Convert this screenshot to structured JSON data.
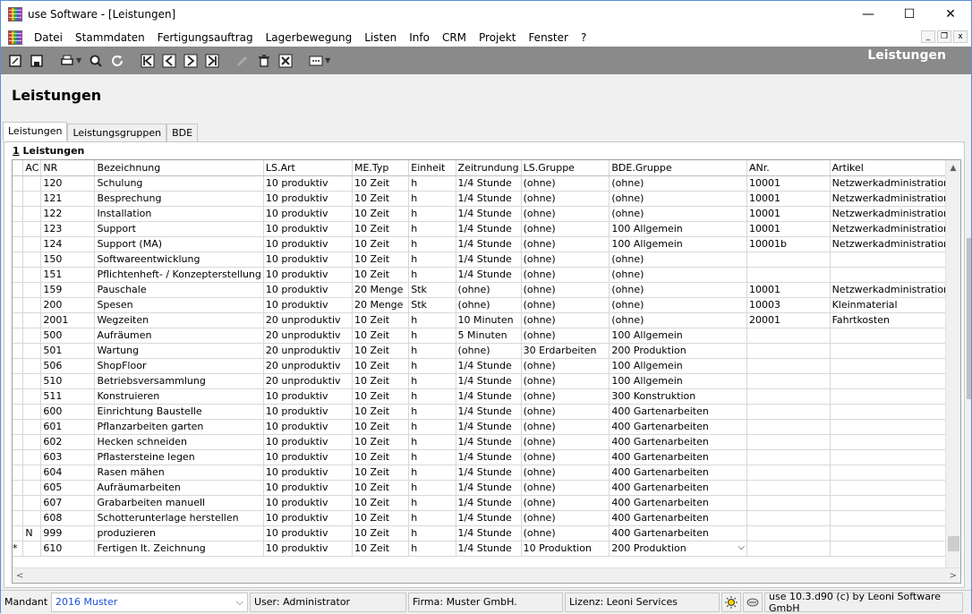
{
  "window": {
    "title": "use Software - [Leistungen]",
    "minimize": "—",
    "maximize": "☐",
    "close": "✕"
  },
  "menu": [
    "Datei",
    "Stammdaten",
    "Fertigungsauftrag",
    "Lagerbewegung",
    "Listen",
    "Info",
    "CRM",
    "Projekt",
    "Fenster",
    "?"
  ],
  "mdi": {
    "minimize": "_",
    "restore": "❐",
    "close": "x"
  },
  "toolbar": {
    "title": "Leistungen",
    "icons": [
      "new-icon",
      "save-icon",
      "print-icon",
      "search-icon",
      "refresh-icon",
      "first-record-icon",
      "previous-record-icon",
      "next-record-icon",
      "last-record-icon",
      "edit-icon",
      "delete-icon",
      "cancel-icon",
      "more-icon"
    ]
  },
  "page": {
    "title": "Leistungen",
    "tabs": [
      "Leistungen",
      "Leistungsgruppen",
      "BDE"
    ],
    "active_tab": "Leistungen",
    "group_number": "1",
    "group_label": " Leistungen"
  },
  "grid": {
    "columns": [
      "",
      "AC",
      "NR",
      "Bezeichnung",
      "LS.Art",
      "ME.Typ",
      "Einheit",
      "Zeitrundung",
      "LS.Gruppe",
      "BDE.Gruppe",
      "ANr.",
      "Artikel"
    ],
    "rows": [
      [
        "",
        "",
        "120",
        "Schulung",
        "10  produktiv",
        "10  Zeit",
        "h",
        "1/4 Stunde",
        "(ohne)",
        "(ohne)",
        "10001",
        "Netzwerkadministration"
      ],
      [
        "",
        "",
        "121",
        "Besprechung",
        "10  produktiv",
        "10  Zeit",
        "h",
        "1/4 Stunde",
        "(ohne)",
        "(ohne)",
        "10001",
        "Netzwerkadministration"
      ],
      [
        "",
        "",
        "122",
        "Installation",
        "10  produktiv",
        "10  Zeit",
        "h",
        "1/4 Stunde",
        "(ohne)",
        "(ohne)",
        "10001",
        "Netzwerkadministration"
      ],
      [
        "",
        "",
        "123",
        "Support",
        "10  produktiv",
        "10  Zeit",
        "h",
        "1/4 Stunde",
        "(ohne)",
        "100  Allgemein",
        "10001",
        "Netzwerkadministration"
      ],
      [
        "",
        "",
        "124",
        "Support (MA)",
        "10  produktiv",
        "10  Zeit",
        "h",
        "1/4 Stunde",
        "(ohne)",
        "100  Allgemein",
        "10001b",
        "Netzwerkadministration"
      ],
      [
        "",
        "",
        "150",
        "Softwareentwicklung",
        "10  produktiv",
        "10  Zeit",
        "h",
        "1/4 Stunde",
        "(ohne)",
        "(ohne)",
        "",
        ""
      ],
      [
        "",
        "",
        "151",
        "Pflichtenheft- / Konzepterstellung",
        "10  produktiv",
        "10  Zeit",
        "h",
        "1/4 Stunde",
        "(ohne)",
        "(ohne)",
        "",
        ""
      ],
      [
        "",
        "",
        "159",
        "Pauschale",
        "10  produktiv",
        "20  Menge",
        "Stk",
        "(ohne)",
        "(ohne)",
        "(ohne)",
        "10001",
        "Netzwerkadministration"
      ],
      [
        "",
        "",
        "200",
        "Spesen",
        "10  produktiv",
        "20  Menge",
        "Stk",
        "(ohne)",
        "(ohne)",
        "(ohne)",
        "10003",
        "Kleinmaterial"
      ],
      [
        "",
        "",
        "2001",
        "Wegzeiten",
        "20  unproduktiv",
        "10  Zeit",
        "h",
        "10 Minuten",
        "(ohne)",
        "(ohne)",
        "20001",
        "Fahrtkosten"
      ],
      [
        "",
        "",
        "500",
        "Aufräumen",
        "20  unproduktiv",
        "10  Zeit",
        "h",
        "5 Minuten",
        "(ohne)",
        "100  Allgemein",
        "",
        ""
      ],
      [
        "",
        "",
        "501",
        "Wartung",
        "20  unproduktiv",
        "10  Zeit",
        "h",
        "(ohne)",
        "30  Erdarbeiten",
        "200  Produktion",
        "",
        ""
      ],
      [
        "",
        "",
        "506",
        "ShopFloor",
        "20  unproduktiv",
        "10  Zeit",
        "h",
        "1/4 Stunde",
        "(ohne)",
        "100  Allgemein",
        "",
        ""
      ],
      [
        "",
        "",
        "510",
        "Betriebsversammlung",
        "20  unproduktiv",
        "10  Zeit",
        "h",
        "1/4 Stunde",
        "(ohne)",
        "100  Allgemein",
        "",
        ""
      ],
      [
        "",
        "",
        "511",
        "Konstruieren",
        "10  produktiv",
        "10  Zeit",
        "h",
        "1/4 Stunde",
        "(ohne)",
        "300  Konstruktion",
        "",
        ""
      ],
      [
        "",
        "",
        "600",
        "Einrichtung Baustelle",
        "10  produktiv",
        "10  Zeit",
        "h",
        "1/4 Stunde",
        "(ohne)",
        "400  Gartenarbeiten",
        "",
        ""
      ],
      [
        "",
        "",
        "601",
        "Pflanzarbeiten garten",
        "10  produktiv",
        "10  Zeit",
        "h",
        "1/4 Stunde",
        "(ohne)",
        "400  Gartenarbeiten",
        "",
        ""
      ],
      [
        "",
        "",
        "602",
        "Hecken schneiden",
        "10  produktiv",
        "10  Zeit",
        "h",
        "1/4 Stunde",
        "(ohne)",
        "400  Gartenarbeiten",
        "",
        ""
      ],
      [
        "",
        "",
        "603",
        "Pflastersteine legen",
        "10  produktiv",
        "10  Zeit",
        "h",
        "1/4 Stunde",
        "(ohne)",
        "400  Gartenarbeiten",
        "",
        ""
      ],
      [
        "",
        "",
        "604",
        "Rasen mähen",
        "10  produktiv",
        "10  Zeit",
        "h",
        "1/4 Stunde",
        "(ohne)",
        "400  Gartenarbeiten",
        "",
        ""
      ],
      [
        "",
        "",
        "605",
        "Aufräumarbeiten",
        "10  produktiv",
        "10  Zeit",
        "h",
        "1/4 Stunde",
        "(ohne)",
        "400  Gartenarbeiten",
        "",
        ""
      ],
      [
        "",
        "",
        "607",
        "Grabarbeiten manuell",
        "10  produktiv",
        "10  Zeit",
        "h",
        "1/4 Stunde",
        "(ohne)",
        "400  Gartenarbeiten",
        "",
        ""
      ],
      [
        "",
        "",
        "608",
        "Schotterunterlage herstellen",
        "10  produktiv",
        "10  Zeit",
        "h",
        "1/4 Stunde",
        "(ohne)",
        "400  Gartenarbeiten",
        "",
        ""
      ],
      [
        "",
        "N",
        "999",
        "produzieren",
        "10  produktiv",
        "10  Zeit",
        "h",
        "1/4 Stunde",
        "(ohne)",
        "400  Gartenarbeiten",
        "",
        ""
      ],
      [
        "*",
        "",
        "610",
        "Fertigen lt. Zeichnung",
        "10  produktiv",
        "10  Zeit",
        "h",
        "1/4 Stunde",
        "10  Produktion",
        "200  Produktion",
        "",
        ""
      ]
    ]
  },
  "status": {
    "mandant_label": "Mandant",
    "mandant_value": "2016 Muster",
    "user": "User: Administrator",
    "firma": "Firma: Muster GmbH.",
    "lizenz": "Lizenz: Leoni Services",
    "version": "use 10.3.d90 (c) by Leoni Software GmbH",
    "accent": "#1a4fd8"
  }
}
